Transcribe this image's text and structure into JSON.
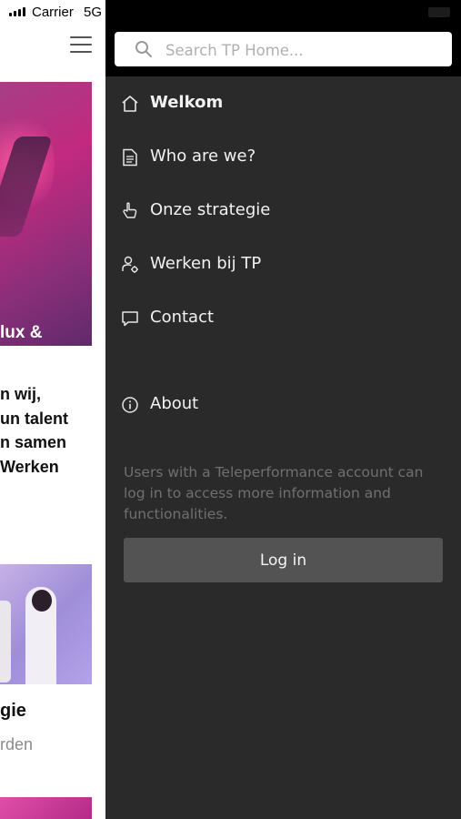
{
  "statusbar": {
    "carrier": "Carrier",
    "network": "5G"
  },
  "background_page": {
    "hero_text": "lux &",
    "intro_lines": [
      "n wij,",
      "un talent",
      "n samen",
      " Werken"
    ],
    "card_title": "gie",
    "card_subtitle": "rden"
  },
  "drawer": {
    "search": {
      "placeholder": "Search TP Home..."
    },
    "menu": [
      {
        "label": "Welkom",
        "icon": "home-icon",
        "active": true
      },
      {
        "label": "Who are we?",
        "icon": "document-icon"
      },
      {
        "label": "Onze strategie",
        "icon": "hand-pointer-icon"
      },
      {
        "label": "Werken bij TP",
        "icon": "user-gear-icon"
      },
      {
        "label": "Contact",
        "icon": "chat-bubble-icon"
      },
      {
        "label": "About",
        "icon": "info-icon"
      }
    ],
    "info_text": "Users with a Teleperformance account can log in to access more information and functionalities.",
    "login_label": "Log in"
  },
  "colors": {
    "drawer_bg": "#2a2a2a",
    "drawer_header_bg": "#000000",
    "login_button_bg": "#535353",
    "hero_magenta": "#c2297f"
  }
}
